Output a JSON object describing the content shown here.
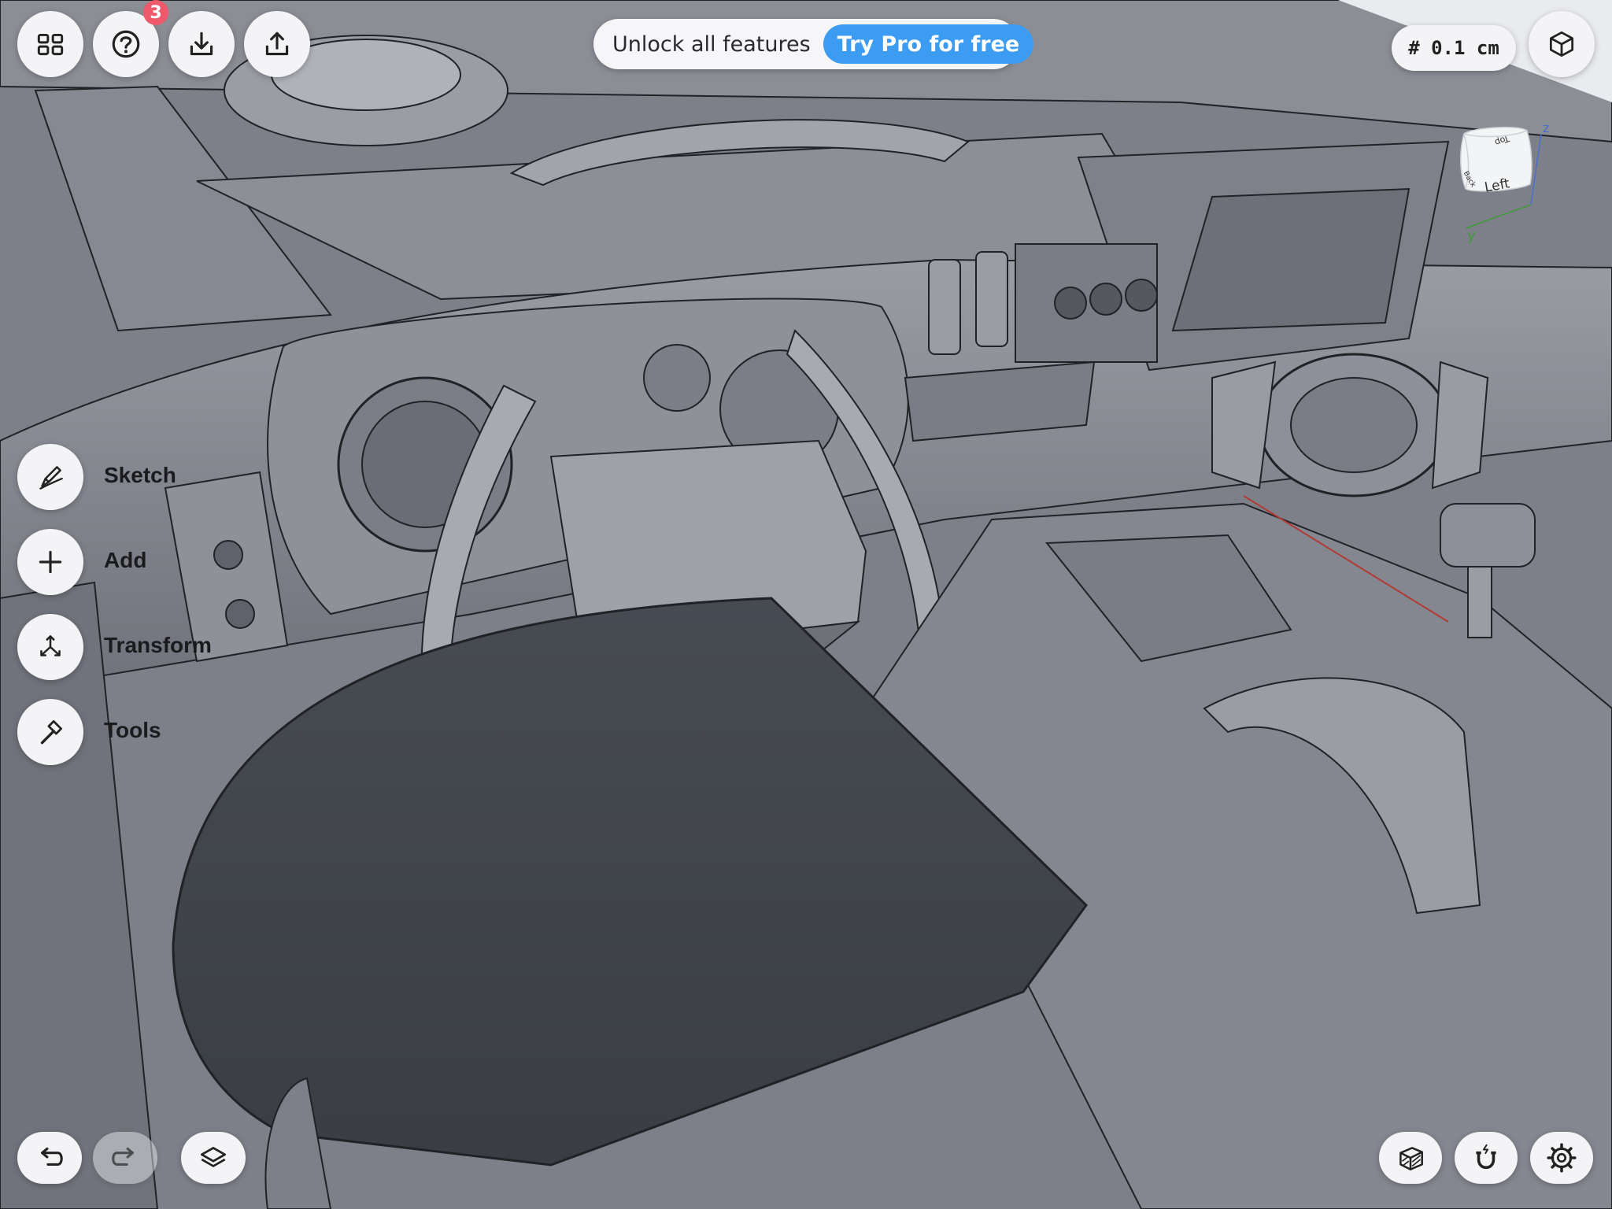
{
  "toolbar": {
    "help_badge": "3"
  },
  "promo": {
    "text": "Unlock all features",
    "cta": "Try Pro for free"
  },
  "grid": {
    "label": "# 0.1 cm"
  },
  "view_cube": {
    "face_left": "Left",
    "face_top": "Top",
    "face_back": "Back",
    "axis_z": "z",
    "axis_y": "y"
  },
  "tools": {
    "sketch": "Sketch",
    "add": "Add",
    "transform": "Transform",
    "tools": "Tools"
  },
  "colors": {
    "accent": "#3c9cf2",
    "badge": "#ee5a6b"
  }
}
